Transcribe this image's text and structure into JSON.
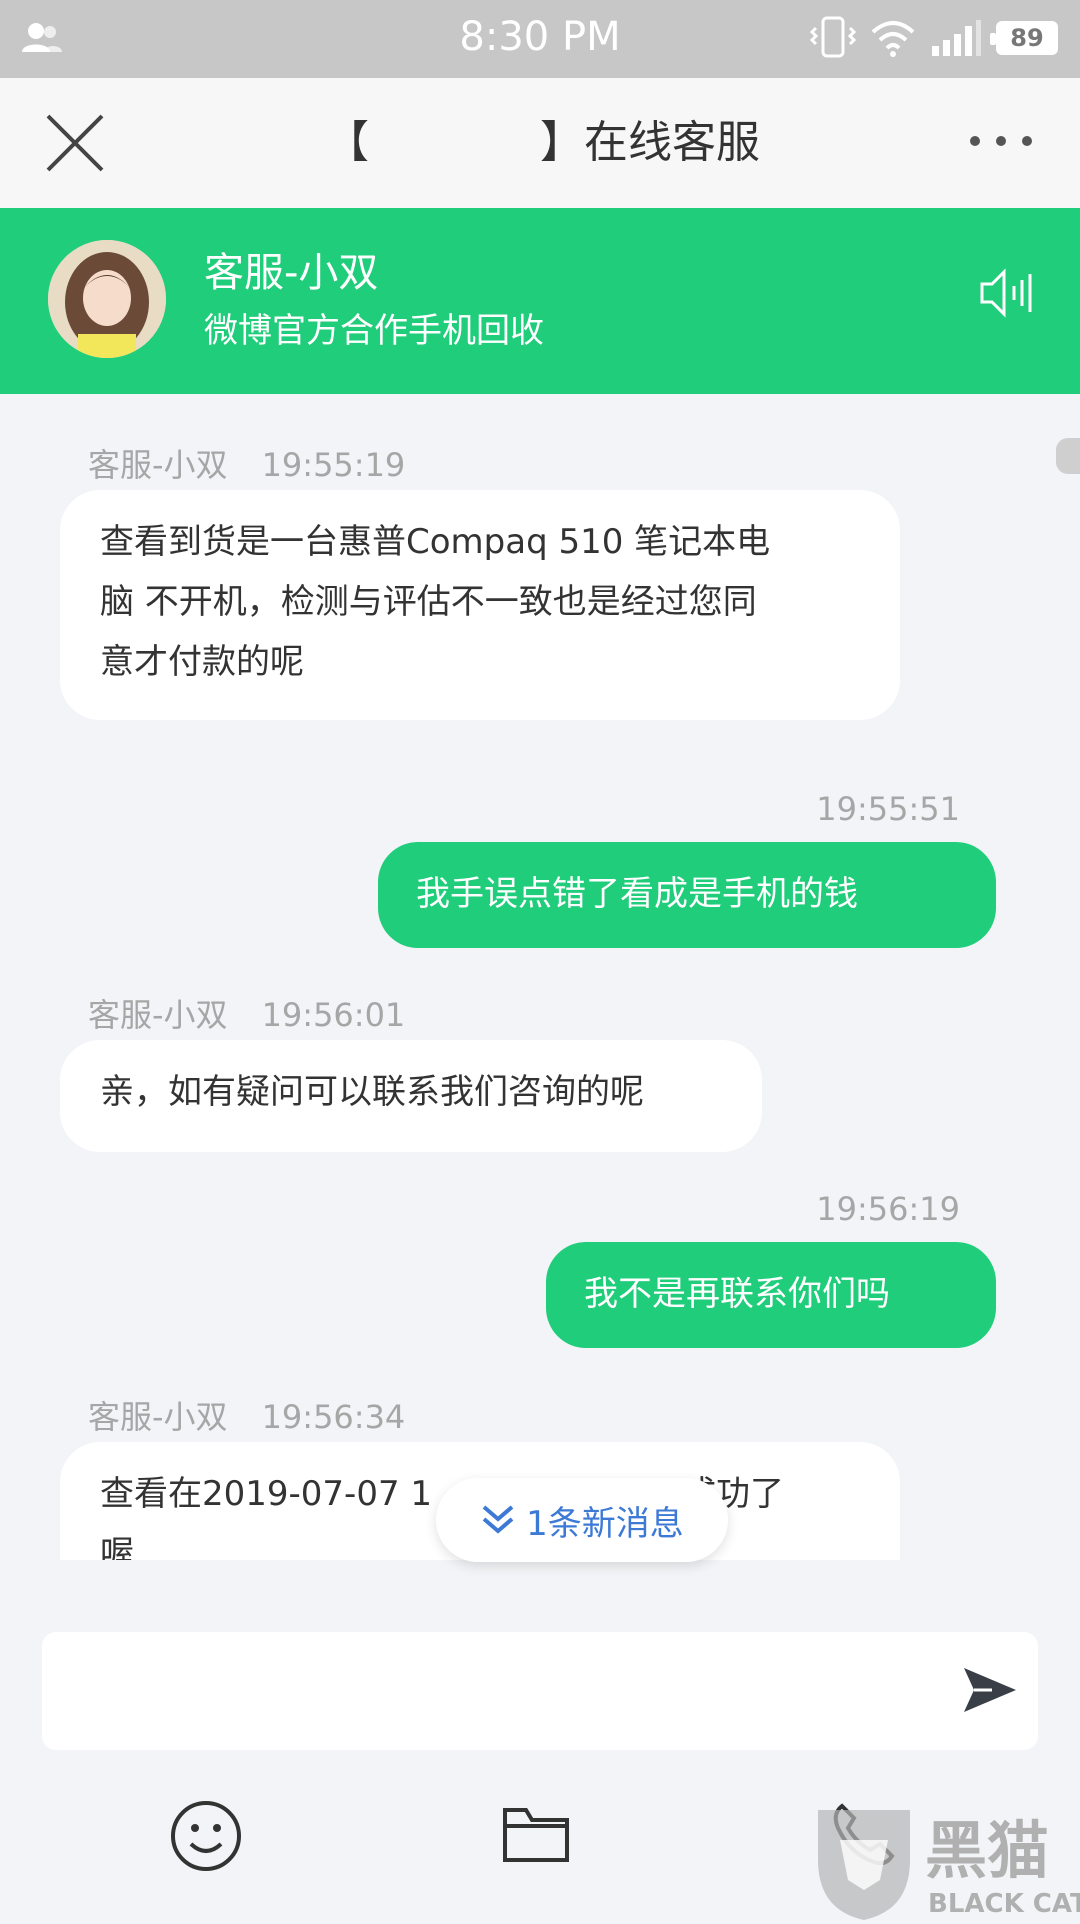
{
  "status_bar": {
    "time": "8:30 PM",
    "battery": "89"
  },
  "nav": {
    "title_left": "【",
    "title_right": "】在线客服"
  },
  "agent": {
    "name": "客服-小双",
    "subtitle": "微博官方合作手机回收"
  },
  "messages": [
    {
      "sender": "agent",
      "name": "客服-小双",
      "time": "19:55:19",
      "lines": [
        "查看到货是一台惠普Compaq 510 笔记本电",
        "脑 不开机，检测与评估不一致也是经过您同",
        "意才付款的呢"
      ]
    },
    {
      "sender": "me",
      "time": "19:55:51",
      "lines": [
        "我手误点错了看成是手机的钱"
      ]
    },
    {
      "sender": "agent",
      "name": "客服-小双",
      "time": "19:56:01",
      "lines": [
        "亲，如有疑问可以联系我们咨询的呢"
      ]
    },
    {
      "sender": "me",
      "time": "19:56:19",
      "lines": [
        "我不是再联系你们吗"
      ]
    },
    {
      "sender": "agent",
      "name": "客服-小双",
      "time": "19:56:34",
      "lines": [
        "查看在2019-07-07 1",
        "成功了",
        "喔"
      ]
    }
  ],
  "new_message_pill": "1条新消息",
  "composer": {
    "placeholder": ""
  },
  "toolbar": {
    "icons": [
      "emoji-icon",
      "folder-icon",
      "phone-icon"
    ]
  },
  "watermark": {
    "text_cn": "黑猫",
    "text_en": "BLACK CAT"
  },
  "colors": {
    "accent": "#1fcd7a",
    "background": "#f2f4f7",
    "link": "#3d7ad6"
  }
}
